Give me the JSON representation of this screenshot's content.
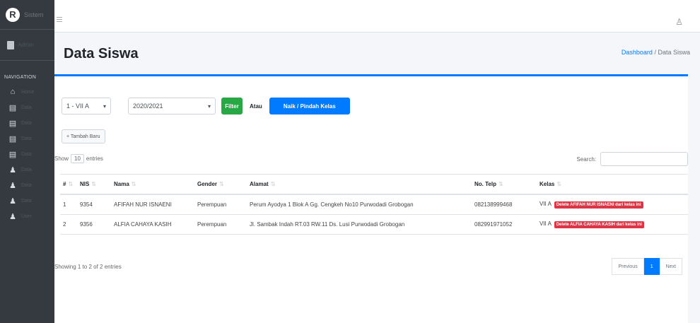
{
  "brand": {
    "logo": "R",
    "text": "Sistem"
  },
  "user_panel": {
    "text": "Admin"
  },
  "sidebar": {
    "header": "NAVIGATION",
    "items": [
      {
        "icon": "home-icon",
        "glyph": "⌂",
        "label": "Home"
      },
      {
        "icon": "book-icon",
        "glyph": "▤",
        "label": "Data"
      },
      {
        "icon": "book-icon",
        "glyph": "▤",
        "label": "Data"
      },
      {
        "icon": "book-icon",
        "glyph": "▤",
        "label": "Data"
      },
      {
        "icon": "book-icon",
        "glyph": "▤",
        "label": "Data"
      },
      {
        "icon": "users-icon",
        "glyph": "♟",
        "label": "Data"
      },
      {
        "icon": "users-icon",
        "glyph": "♟",
        "label": "Data"
      },
      {
        "icon": "users-icon",
        "glyph": "♟",
        "label": "Data"
      },
      {
        "icon": "users-icon",
        "glyph": "♟",
        "label": "User"
      }
    ]
  },
  "header": {
    "title": "Data Siswa",
    "breadcrumb_home": "Dashboard",
    "breadcrumb_sep": "/",
    "breadcrumb_current": "Data Siswa"
  },
  "controls": {
    "kelas_value": "1 - VII A",
    "tahun_value": "2020/2021",
    "filter_label": "Filter",
    "atau_label": "Atau",
    "naik_label": "Naik / Pindah Kelas",
    "tambah_label": "+ Tambah Baru"
  },
  "table_tools": {
    "show_label": "Show",
    "show_value": "10",
    "entries_label": "entries",
    "search_label": "Search:"
  },
  "table": {
    "columns": [
      "#",
      "NIS",
      "Nama",
      "Gender",
      "Alamat",
      "No. Telp",
      "Kelas"
    ],
    "rows": [
      {
        "no": "1",
        "nis": "9354",
        "nama": "AFIFAH NUR ISNAENI",
        "gender": "Perempuan",
        "alamat": "Perum Ayodya 1 Blok A Gg. Cengkeh No10 Purwodadi Grobogan",
        "telp": "082138999468",
        "kelas": "VII A",
        "badge": "Delete AFIFAH NUR ISNAENI dari kelas ini"
      },
      {
        "no": "2",
        "nis": "9356",
        "nama": "ALFIA CAHAYA KASIH",
        "gender": "Perempuan",
        "alamat": "Jl. Sambak Indah RT.03 RW.11 Ds. Lusi Purwodadi Grobogan",
        "telp": "082991971052",
        "kelas": "VII A",
        "badge": "Delete ALFIA CAHAYA KASIH dari kelas ini"
      }
    ]
  },
  "footer": {
    "showing": "Showing 1 to 2 of 2 entries",
    "prev": "Previous",
    "page": "1",
    "next": "Next"
  },
  "colors": {
    "primary": "#007bff",
    "success": "#28a745",
    "danger": "#dc3545",
    "sidebar": "#343a40"
  }
}
